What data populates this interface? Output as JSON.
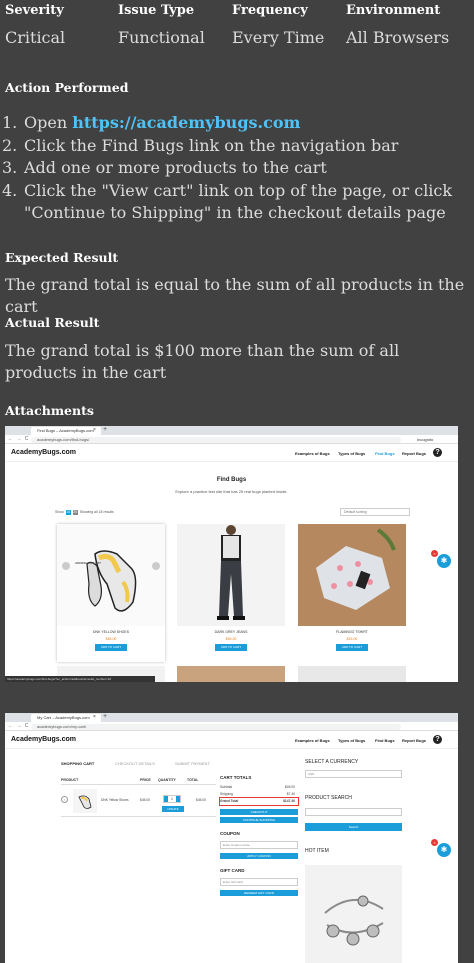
{
  "table": {
    "headers": [
      "Severity",
      "Issue Type",
      "Frequency",
      "Environment"
    ],
    "values": [
      "Critical",
      "Functional",
      "Every Time",
      "All Browsers"
    ]
  },
  "action": {
    "heading": "Action Performed",
    "steps": [
      {
        "num": "1.",
        "prefix": "Open ",
        "link": "https://academybugs.com",
        "text": ""
      },
      {
        "num": "2.",
        "prefix": "",
        "link": "",
        "text": "Click the Find Bugs link on the navigation bar"
      },
      {
        "num": "3.",
        "prefix": "",
        "link": "",
        "text": "Add one or more products to the cart"
      },
      {
        "num": "4.",
        "prefix": "",
        "link": "",
        "text": "Click the \"View cart\" link on top of the page, or click \"Continue to Shipping\" in the checkout details page"
      }
    ]
  },
  "expected": {
    "heading": "Expected Result",
    "text": "The grand total is equal to the sum of all products in the cart"
  },
  "actual": {
    "heading": "Actual Result",
    "text": "The grand total is $100 more than the sum of all products in the cart"
  },
  "attachments": {
    "heading": "Attachments"
  },
  "screenshot1": {
    "tab_title": "Find Bugs – AcademyBugs.com",
    "url": "academybugs.com/find-bugs/",
    "incognito": "Incognito",
    "logo": "AcademyBugs.com",
    "nav": [
      "Examples of Bugs",
      "Types of Bugs",
      "Find Bugs",
      "Report Bugs"
    ],
    "help": "?",
    "title": "Find Bugs",
    "subtitle": "Explore a practice test site that has 25 real bugs planted inside.",
    "show_prefix": "Show",
    "per_page": [
      "10",
      "20"
    ],
    "showing": "Showing all 18 results",
    "sort": "Default sorting",
    "products": [
      {
        "name": "DNK YELLOW SHOES",
        "price": "$45.00",
        "button": "ADD TO CART",
        "hover": "ADDING TO CART"
      },
      {
        "name": "DARK GREY JEANS",
        "price": "$45.00",
        "button": "ADD TO CART"
      },
      {
        "name": "FLAMINGO TSHIRT",
        "price": "$15.00",
        "button": "ADD TO CART"
      }
    ],
    "status": "https://academybugs.com/find-bugs/?ec_action=addtocart&model_number=1#"
  },
  "screenshot2": {
    "tab_title": "My Cart – AcademyBugs.com",
    "url": "academybugs.com/my-cart/",
    "logo": "AcademyBugs.com",
    "nav": [
      "Examples of Bugs",
      "Types of Bugs",
      "Find Bugs",
      "Report Bugs"
    ],
    "help": "?",
    "checkout_steps": [
      "SHOPPING CART",
      "CHECKOUT DETAILS",
      "SUBMIT PAYMENT"
    ],
    "columns": [
      "PRODUCT",
      "PRICE",
      "QUANTITY",
      "TOTAL"
    ],
    "item": {
      "name": "DNK Yellow Shoes",
      "price": "$45.00",
      "qty": "1",
      "total": "$45.00",
      "update": "UPDATE"
    },
    "totals_heading": "CART TOTALS",
    "totals": [
      {
        "label": "Subtotal",
        "value": "$45.00"
      },
      {
        "label": "Shipping",
        "value": "$7.40"
      },
      {
        "label": "Grand Total",
        "value": "$147.40"
      }
    ],
    "checkout_btn": "CHECKOUT",
    "continue_btn": "CONTINUE SHOPPING",
    "coupon_heading": "COUPON",
    "coupon_placeholder": "Enter Coupon Code",
    "coupon_btn": "APPLY COUPON",
    "gift_heading": "GIFT CARD",
    "gift_placeholder": "Enter Gift Card",
    "gift_btn": "REDEEM GIFT CARD",
    "currency_heading": "SELECT A CURRENCY",
    "currency_value": "USD",
    "search_heading": "PRODUCT SEARCH",
    "search_btn": "Search",
    "hot_heading": "HOT ITEM"
  },
  "colors": {
    "bg": "#414141",
    "link": "#4fc3f7",
    "accent": "#1a9dd9",
    "alert": "#e53935"
  }
}
